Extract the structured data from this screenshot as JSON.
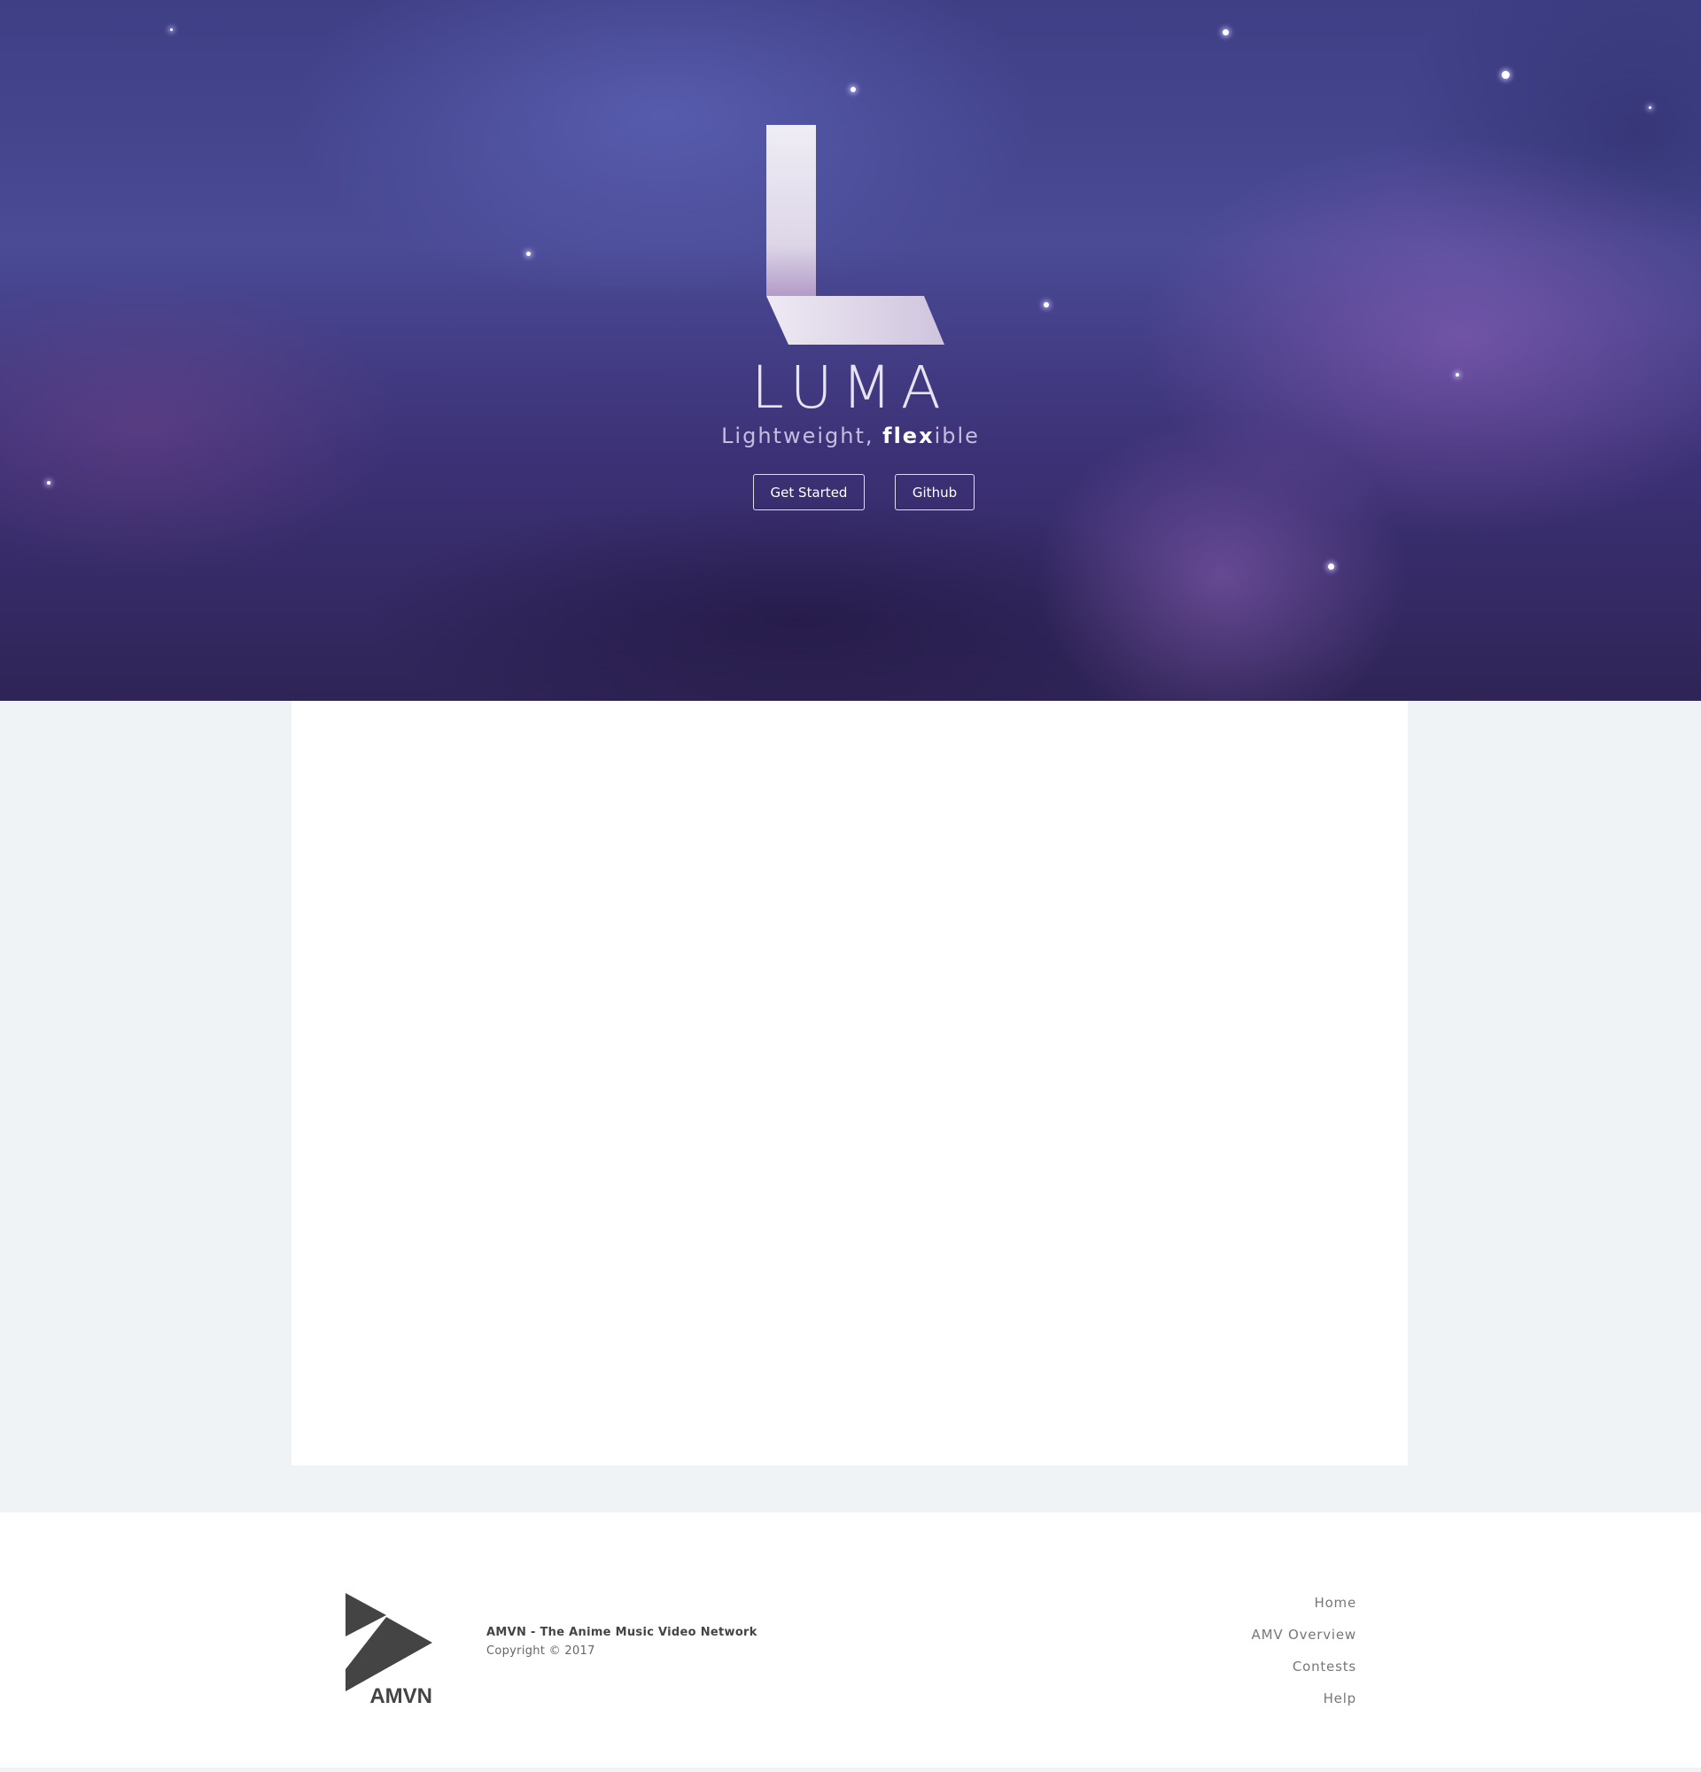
{
  "hero": {
    "title": "LUMA",
    "tagline_part1": "Lightweight, ",
    "tagline_strong": "flex",
    "tagline_part2": "ible",
    "buttons": {
      "get_started": "Get Started",
      "github": "Github"
    }
  },
  "footer": {
    "logo_text": "AMVN",
    "brand": "AMVN - The Anime Music Video Network",
    "copyright": "Copyright © 2017",
    "nav": [
      "Home",
      "AMV Overview",
      "Contests",
      "Help"
    ]
  },
  "colors": {
    "hero_text": "#e8e3f2",
    "page_background": "#eff3f6",
    "card_background": "#ffffff",
    "footer_text": "#444444",
    "footer_link": "#777777"
  },
  "icons": {
    "hero_logo": "luma-l-logo-icon",
    "footer_logo": "amvn-play-logo-icon"
  }
}
